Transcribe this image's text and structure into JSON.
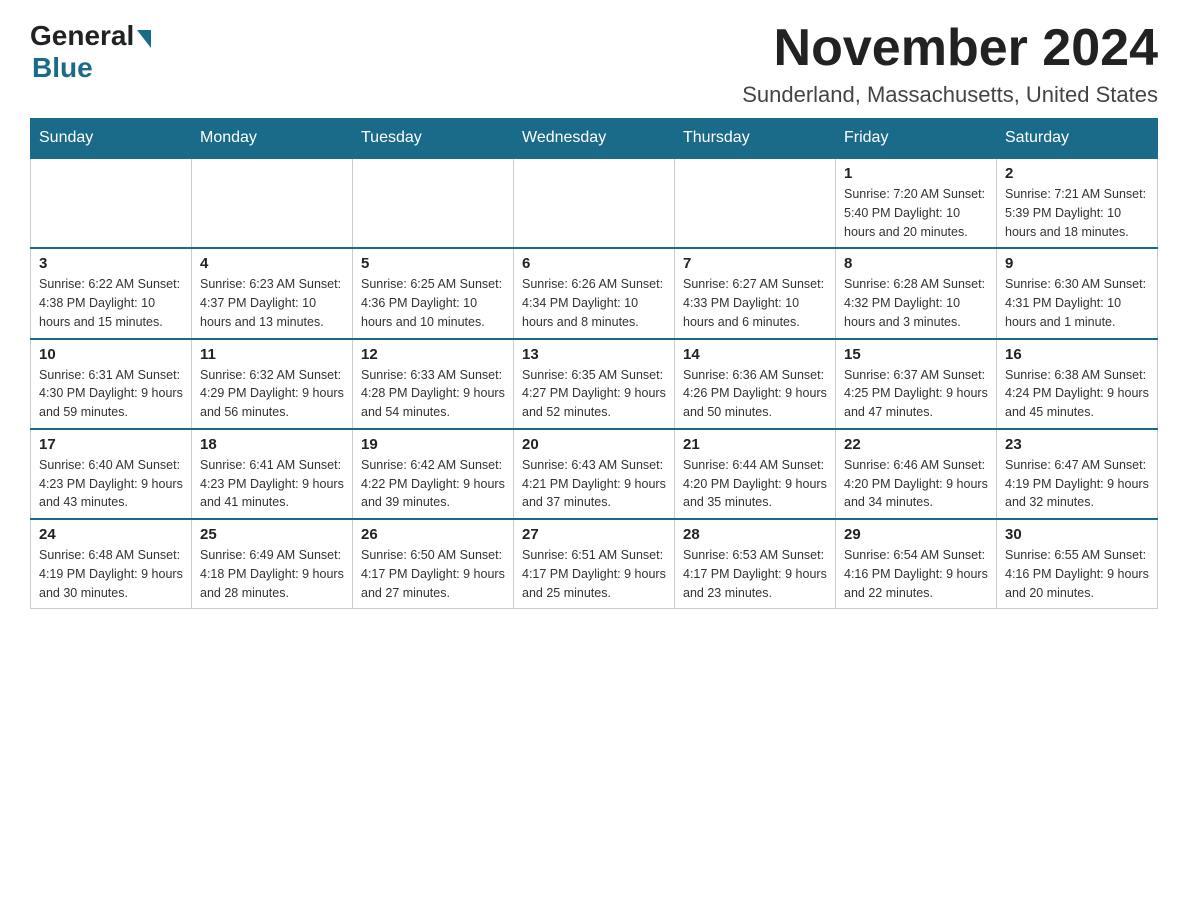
{
  "logo": {
    "general": "General",
    "blue": "Blue"
  },
  "title": "November 2024",
  "location": "Sunderland, Massachusetts, United States",
  "days_of_week": [
    "Sunday",
    "Monday",
    "Tuesday",
    "Wednesday",
    "Thursday",
    "Friday",
    "Saturday"
  ],
  "weeks": [
    [
      {
        "day": "",
        "info": ""
      },
      {
        "day": "",
        "info": ""
      },
      {
        "day": "",
        "info": ""
      },
      {
        "day": "",
        "info": ""
      },
      {
        "day": "",
        "info": ""
      },
      {
        "day": "1",
        "info": "Sunrise: 7:20 AM\nSunset: 5:40 PM\nDaylight: 10 hours\nand 20 minutes."
      },
      {
        "day": "2",
        "info": "Sunrise: 7:21 AM\nSunset: 5:39 PM\nDaylight: 10 hours\nand 18 minutes."
      }
    ],
    [
      {
        "day": "3",
        "info": "Sunrise: 6:22 AM\nSunset: 4:38 PM\nDaylight: 10 hours\nand 15 minutes."
      },
      {
        "day": "4",
        "info": "Sunrise: 6:23 AM\nSunset: 4:37 PM\nDaylight: 10 hours\nand 13 minutes."
      },
      {
        "day": "5",
        "info": "Sunrise: 6:25 AM\nSunset: 4:36 PM\nDaylight: 10 hours\nand 10 minutes."
      },
      {
        "day": "6",
        "info": "Sunrise: 6:26 AM\nSunset: 4:34 PM\nDaylight: 10 hours\nand 8 minutes."
      },
      {
        "day": "7",
        "info": "Sunrise: 6:27 AM\nSunset: 4:33 PM\nDaylight: 10 hours\nand 6 minutes."
      },
      {
        "day": "8",
        "info": "Sunrise: 6:28 AM\nSunset: 4:32 PM\nDaylight: 10 hours\nand 3 minutes."
      },
      {
        "day": "9",
        "info": "Sunrise: 6:30 AM\nSunset: 4:31 PM\nDaylight: 10 hours\nand 1 minute."
      }
    ],
    [
      {
        "day": "10",
        "info": "Sunrise: 6:31 AM\nSunset: 4:30 PM\nDaylight: 9 hours\nand 59 minutes."
      },
      {
        "day": "11",
        "info": "Sunrise: 6:32 AM\nSunset: 4:29 PM\nDaylight: 9 hours\nand 56 minutes."
      },
      {
        "day": "12",
        "info": "Sunrise: 6:33 AM\nSunset: 4:28 PM\nDaylight: 9 hours\nand 54 minutes."
      },
      {
        "day": "13",
        "info": "Sunrise: 6:35 AM\nSunset: 4:27 PM\nDaylight: 9 hours\nand 52 minutes."
      },
      {
        "day": "14",
        "info": "Sunrise: 6:36 AM\nSunset: 4:26 PM\nDaylight: 9 hours\nand 50 minutes."
      },
      {
        "day": "15",
        "info": "Sunrise: 6:37 AM\nSunset: 4:25 PM\nDaylight: 9 hours\nand 47 minutes."
      },
      {
        "day": "16",
        "info": "Sunrise: 6:38 AM\nSunset: 4:24 PM\nDaylight: 9 hours\nand 45 minutes."
      }
    ],
    [
      {
        "day": "17",
        "info": "Sunrise: 6:40 AM\nSunset: 4:23 PM\nDaylight: 9 hours\nand 43 minutes."
      },
      {
        "day": "18",
        "info": "Sunrise: 6:41 AM\nSunset: 4:23 PM\nDaylight: 9 hours\nand 41 minutes."
      },
      {
        "day": "19",
        "info": "Sunrise: 6:42 AM\nSunset: 4:22 PM\nDaylight: 9 hours\nand 39 minutes."
      },
      {
        "day": "20",
        "info": "Sunrise: 6:43 AM\nSunset: 4:21 PM\nDaylight: 9 hours\nand 37 minutes."
      },
      {
        "day": "21",
        "info": "Sunrise: 6:44 AM\nSunset: 4:20 PM\nDaylight: 9 hours\nand 35 minutes."
      },
      {
        "day": "22",
        "info": "Sunrise: 6:46 AM\nSunset: 4:20 PM\nDaylight: 9 hours\nand 34 minutes."
      },
      {
        "day": "23",
        "info": "Sunrise: 6:47 AM\nSunset: 4:19 PM\nDaylight: 9 hours\nand 32 minutes."
      }
    ],
    [
      {
        "day": "24",
        "info": "Sunrise: 6:48 AM\nSunset: 4:19 PM\nDaylight: 9 hours\nand 30 minutes."
      },
      {
        "day": "25",
        "info": "Sunrise: 6:49 AM\nSunset: 4:18 PM\nDaylight: 9 hours\nand 28 minutes."
      },
      {
        "day": "26",
        "info": "Sunrise: 6:50 AM\nSunset: 4:17 PM\nDaylight: 9 hours\nand 27 minutes."
      },
      {
        "day": "27",
        "info": "Sunrise: 6:51 AM\nSunset: 4:17 PM\nDaylight: 9 hours\nand 25 minutes."
      },
      {
        "day": "28",
        "info": "Sunrise: 6:53 AM\nSunset: 4:17 PM\nDaylight: 9 hours\nand 23 minutes."
      },
      {
        "day": "29",
        "info": "Sunrise: 6:54 AM\nSunset: 4:16 PM\nDaylight: 9 hours\nand 22 minutes."
      },
      {
        "day": "30",
        "info": "Sunrise: 6:55 AM\nSunset: 4:16 PM\nDaylight: 9 hours\nand 20 minutes."
      }
    ]
  ]
}
